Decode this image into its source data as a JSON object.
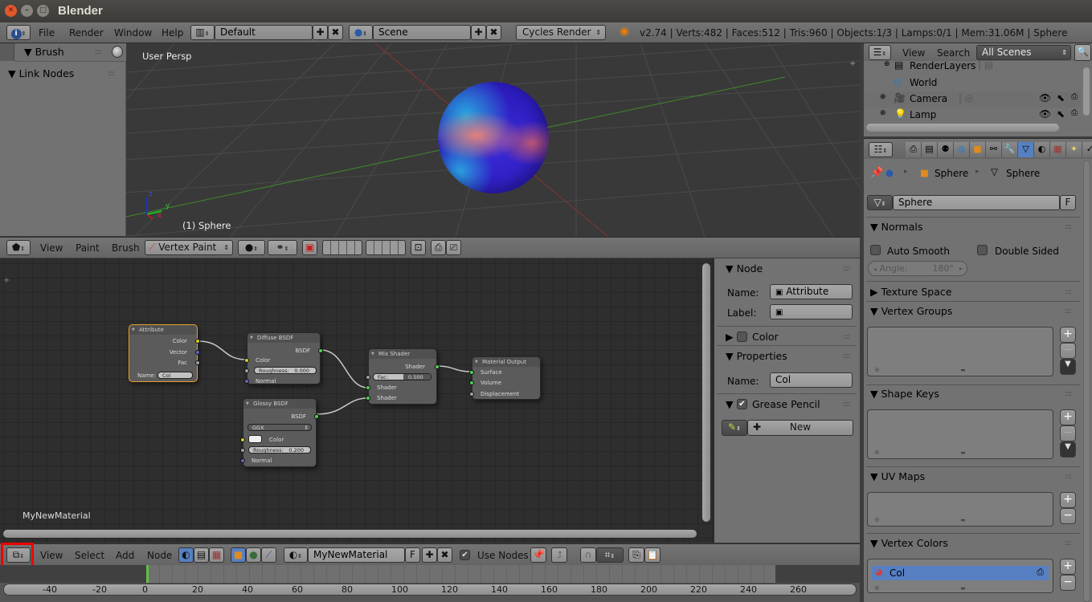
{
  "window": {
    "title": "Blender",
    "controls": [
      "close",
      "minimize",
      "maximize"
    ]
  },
  "info_header": {
    "editor_type_icon": "info-icon",
    "menus": [
      "File",
      "Render",
      "Window",
      "Help"
    ],
    "screen_layout": "Default",
    "scene": "Scene",
    "render_engine": "Cycles Render",
    "stats": "v2.74 | Verts:482 | Faces:512 | Tris:960 | Objects:1/3 | Lamps:0/1 | Mem:31.06M | Sphere"
  },
  "toolshelf": {
    "panels": [
      {
        "label": "Brush",
        "expanded": true
      },
      {
        "label": "Link Nodes",
        "expanded": true
      }
    ]
  },
  "viewport": {
    "view_name": "User Persp",
    "object_label": "(1) Sphere",
    "axis_labels": {
      "x": "x",
      "y": "y",
      "z": "z"
    }
  },
  "viewport_header": {
    "menus": [
      "View",
      "Paint",
      "Brush"
    ],
    "mode": "Vertex Paint"
  },
  "node_editor": {
    "material_label": "MyNewMaterial",
    "nodes": {
      "attribute": {
        "title": "Attribute",
        "outputs": [
          "Color",
          "Vector",
          "Fac"
        ],
        "name_label": "Name:",
        "name_value": "Col"
      },
      "diffuse": {
        "title": "Diffuse BSDF",
        "output": "BSDF",
        "inputs": [
          "Color",
          "Roughness:",
          "Normal"
        ],
        "roughness": "0.000"
      },
      "glossy": {
        "title": "Glossy BSDF",
        "output": "BSDF",
        "distribution": "GGX",
        "inputs": [
          "Color",
          "Roughness:",
          "Normal"
        ],
        "roughness": "0.200"
      },
      "mix": {
        "title": "Mix Shader",
        "output": "Shader",
        "fac_label": "Fac:",
        "fac_value": "0.500",
        "inputs": [
          "Shader",
          "Shader"
        ]
      },
      "output": {
        "title": "Material Output",
        "inputs": [
          "Surface",
          "Volume",
          "Displacement"
        ]
      }
    }
  },
  "node_sidebar": {
    "node_panel": {
      "title": "Node",
      "name_label": "Name:",
      "name_value": "Attribute",
      "label_label": "Label:",
      "label_value": ""
    },
    "color_panel": {
      "title": "Color"
    },
    "properties_panel": {
      "title": "Properties",
      "name_label": "Name:",
      "name_value": "Col"
    },
    "grease_pencil_panel": {
      "title": "Grease Pencil",
      "checked": true,
      "new_label": "New"
    }
  },
  "node_header": {
    "menus": [
      "View",
      "Select",
      "Add",
      "Node"
    ],
    "material_name": "MyNewMaterial",
    "fake_user": "F",
    "use_nodes_label": "Use Nodes",
    "use_nodes_checked": true
  },
  "timeline": {
    "ticks": [
      "-40",
      "-20",
      "0",
      "20",
      "40",
      "60",
      "80",
      "100",
      "120",
      "140",
      "160",
      "180",
      "200",
      "220",
      "240",
      "260"
    ],
    "current_frame": 0
  },
  "outliner": {
    "menus": [
      "View",
      "Search"
    ],
    "display_mode": "All Scenes",
    "items": [
      {
        "label": "RenderLayers",
        "icon": "render-layers-icon"
      },
      {
        "label": "World",
        "icon": "world-icon"
      },
      {
        "label": "Camera",
        "icon": "camera-icon"
      },
      {
        "label": "Lamp",
        "icon": "lamp-icon"
      }
    ]
  },
  "properties": {
    "tabs": [
      "render",
      "render-layers",
      "scene",
      "world",
      "object",
      "constraints",
      "modifiers",
      "data",
      "material",
      "texture",
      "particles",
      "physics"
    ],
    "active_tab": "data",
    "breadcrumb": [
      "Sphere",
      "Sphere"
    ],
    "mesh_name": "Sphere",
    "fake_user": "F",
    "normals": {
      "title": "Normals",
      "auto_smooth": "Auto Smooth",
      "double_sided": "Double Sided",
      "angle_label": "Angle:",
      "angle_value": "180°"
    },
    "texture_space": {
      "title": "Texture Space"
    },
    "vertex_groups": {
      "title": "Vertex Groups"
    },
    "shape_keys": {
      "title": "Shape Keys"
    },
    "uv_maps": {
      "title": "UV Maps"
    },
    "vertex_colors": {
      "title": "Vertex Colors",
      "items": [
        "Col"
      ]
    }
  },
  "colors": {
    "accent_blue": "#5680c2",
    "highlight_red": "#e00000",
    "selected_node_border": "#e8a030",
    "frame_indicator": "#60c040"
  }
}
